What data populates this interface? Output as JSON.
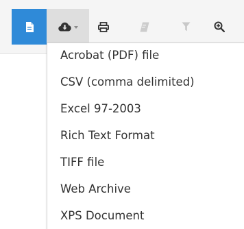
{
  "colors": {
    "toolbar_bg": "#f5f5f5",
    "active_doc_button": "#2f8ad8",
    "pressed_button": "#dedede",
    "icon_dark": "#333333",
    "icon_disabled": "#c8c8c8",
    "menu_text": "#333333"
  },
  "toolbar": {
    "buttons": [
      {
        "name": "document-map",
        "icon": "document-icon",
        "state": "active"
      },
      {
        "name": "export",
        "icon": "cloud-download-icon",
        "state": "pressed",
        "has_dropdown": true
      },
      {
        "name": "print",
        "icon": "print-icon",
        "state": "enabled"
      },
      {
        "name": "print-layout",
        "icon": "page-layout-icon",
        "state": "disabled"
      },
      {
        "name": "filter",
        "icon": "filter-icon",
        "state": "disabled"
      },
      {
        "name": "zoom",
        "icon": "zoom-in-icon",
        "state": "enabled"
      }
    ]
  },
  "export_menu": {
    "items": [
      {
        "label": "Acrobat (PDF) file"
      },
      {
        "label": "CSV (comma delimited)"
      },
      {
        "label": "Excel 97-2003"
      },
      {
        "label": "Rich Text Format"
      },
      {
        "label": "TIFF file"
      },
      {
        "label": "Web Archive"
      },
      {
        "label": "XPS Document"
      }
    ]
  }
}
